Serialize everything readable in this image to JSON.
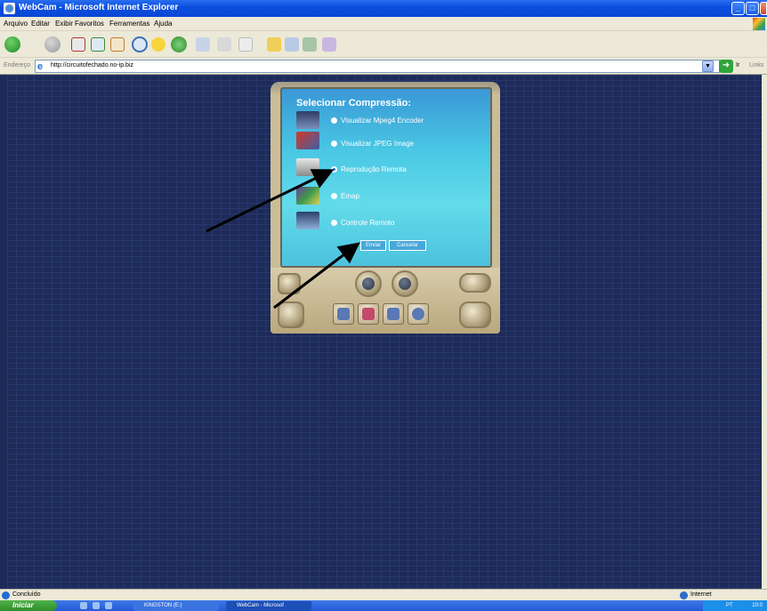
{
  "window": {
    "title": "WebCam - Microsoft Internet Explorer",
    "minimize": "_",
    "maximize": "□",
    "close": "X"
  },
  "menu": [
    "Arquivo",
    "Editar",
    "Exibir",
    "Favoritos",
    "Ferramentas",
    "Ajuda"
  ],
  "address": {
    "label": "Endereço",
    "url": "http://circuitofechado.no-ip.biz",
    "go_label": "Ir",
    "links": "Links"
  },
  "player": {
    "heading": "Selecionar Compressão:",
    "options": [
      {
        "label": "Visualizar Mpeg4 Encoder",
        "checked": false,
        "icon": "film-icon"
      },
      {
        "label": "Visualizar JPEG Image",
        "checked": false,
        "icon": "image-icon"
      },
      {
        "label": "Reprodução Remota",
        "checked": true,
        "icon": "remote-playback-icon"
      },
      {
        "label": "Emap",
        "checked": false,
        "icon": "map-icon"
      },
      {
        "label": "Controle Remoto",
        "checked": false,
        "icon": "monitor-icon"
      }
    ],
    "submit": "Enviar",
    "cancel": "Cancelar"
  },
  "status": {
    "text": "Concluído",
    "zone": "Internet"
  },
  "taskbar": {
    "start": "Iniciar",
    "tasks": [
      "KINGSTON (E:)",
      "WebCam - Microsof"
    ],
    "tray_lang": "PT",
    "clock": "10:0"
  }
}
